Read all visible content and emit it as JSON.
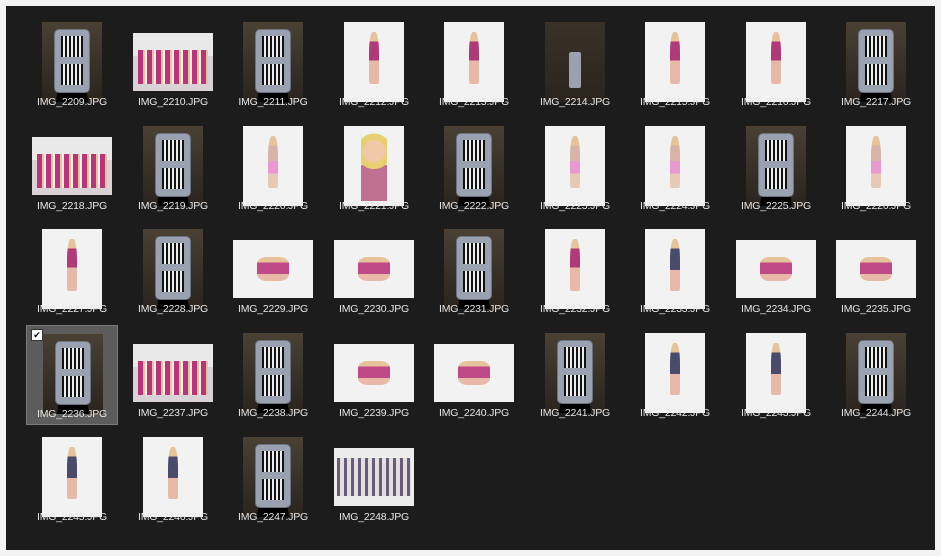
{
  "selected_label": "IMG_2236.JPG",
  "items": [
    {
      "label": "IMG_2209.JPG",
      "kind": "phone",
      "orient": "portrait"
    },
    {
      "label": "IMG_2210.JPG",
      "kind": "group",
      "orient": "landscape"
    },
    {
      "label": "IMG_2211.JPG",
      "kind": "phone",
      "orient": "portrait"
    },
    {
      "label": "IMG_2212.JPG",
      "kind": "studio",
      "orient": "portrait"
    },
    {
      "label": "IMG_2213.JPG",
      "kind": "studio",
      "orient": "portrait"
    },
    {
      "label": "IMG_2214.JPG",
      "kind": "shelf",
      "orient": "portrait"
    },
    {
      "label": "IMG_2215.JPG",
      "kind": "studio",
      "orient": "portrait"
    },
    {
      "label": "IMG_2216.JPG",
      "kind": "studio",
      "orient": "portrait"
    },
    {
      "label": "IMG_2217.JPG",
      "kind": "phone",
      "orient": "portrait"
    },
    {
      "label": "IMG_2218.JPG",
      "kind": "group",
      "orient": "landscape"
    },
    {
      "label": "IMG_2219.JPG",
      "kind": "phone",
      "orient": "portrait"
    },
    {
      "label": "IMG_2220.JPG",
      "kind": "studio",
      "orient": "portrait",
      "variant": "tutu"
    },
    {
      "label": "IMG_2221.JPG",
      "kind": "studio",
      "orient": "portrait",
      "variant": "face"
    },
    {
      "label": "IMG_2222.JPG",
      "kind": "phone",
      "orient": "portrait"
    },
    {
      "label": "IMG_2223.JPG",
      "kind": "studio",
      "orient": "portrait",
      "variant": "tutu"
    },
    {
      "label": "IMG_2224.JPG",
      "kind": "studio",
      "orient": "portrait",
      "variant": "tutu"
    },
    {
      "label": "IMG_2225.JPG",
      "kind": "phone",
      "orient": "portrait"
    },
    {
      "label": "IMG_2226.JPG",
      "kind": "studio",
      "orient": "portrait",
      "variant": "tutu"
    },
    {
      "label": "IMG_2227.JPG",
      "kind": "studio",
      "orient": "portrait"
    },
    {
      "label": "IMG_2228.JPG",
      "kind": "phone",
      "orient": "portrait"
    },
    {
      "label": "IMG_2229.JPG",
      "kind": "studio",
      "orient": "landscape",
      "variant": "wide"
    },
    {
      "label": "IMG_2230.JPG",
      "kind": "studio",
      "orient": "landscape",
      "variant": "wide"
    },
    {
      "label": "IMG_2231.JPG",
      "kind": "phone",
      "orient": "portrait"
    },
    {
      "label": "IMG_2232.JPG",
      "kind": "studio",
      "orient": "portrait"
    },
    {
      "label": "IMG_2233.JPG",
      "kind": "studio",
      "orient": "portrait",
      "variant": "sequin"
    },
    {
      "label": "IMG_2234.JPG",
      "kind": "studio",
      "orient": "landscape",
      "variant": "wide"
    },
    {
      "label": "IMG_2235.JPG",
      "kind": "studio",
      "orient": "landscape",
      "variant": "wide"
    },
    {
      "label": "IMG_2236.JPG",
      "kind": "phone",
      "orient": "portrait",
      "selected": true
    },
    {
      "label": "IMG_2237.JPG",
      "kind": "group",
      "orient": "landscape"
    },
    {
      "label": "IMG_2238.JPG",
      "kind": "phone",
      "orient": "portrait"
    },
    {
      "label": "IMG_2239.JPG",
      "kind": "studio",
      "orient": "landscape",
      "variant": "wide"
    },
    {
      "label": "IMG_2240.JPG",
      "kind": "studio",
      "orient": "landscape",
      "variant": "wide"
    },
    {
      "label": "IMG_2241.JPG",
      "kind": "phone",
      "orient": "portrait"
    },
    {
      "label": "IMG_2242.JPG",
      "kind": "studio",
      "orient": "portrait",
      "variant": "sequin"
    },
    {
      "label": "IMG_2243.JPG",
      "kind": "studio",
      "orient": "portrait",
      "variant": "sequin"
    },
    {
      "label": "IMG_2244.JPG",
      "kind": "phone",
      "orient": "portrait"
    },
    {
      "label": "IMG_2245.JPG",
      "kind": "studio",
      "orient": "portrait",
      "variant": "sequin"
    },
    {
      "label": "IMG_2246.JPG",
      "kind": "studio",
      "orient": "portrait",
      "variant": "sequin"
    },
    {
      "label": "IMG_2247.JPG",
      "kind": "phone",
      "orient": "portrait"
    },
    {
      "label": "IMG_2248.JPG",
      "kind": "lineup",
      "orient": "landscape"
    }
  ]
}
